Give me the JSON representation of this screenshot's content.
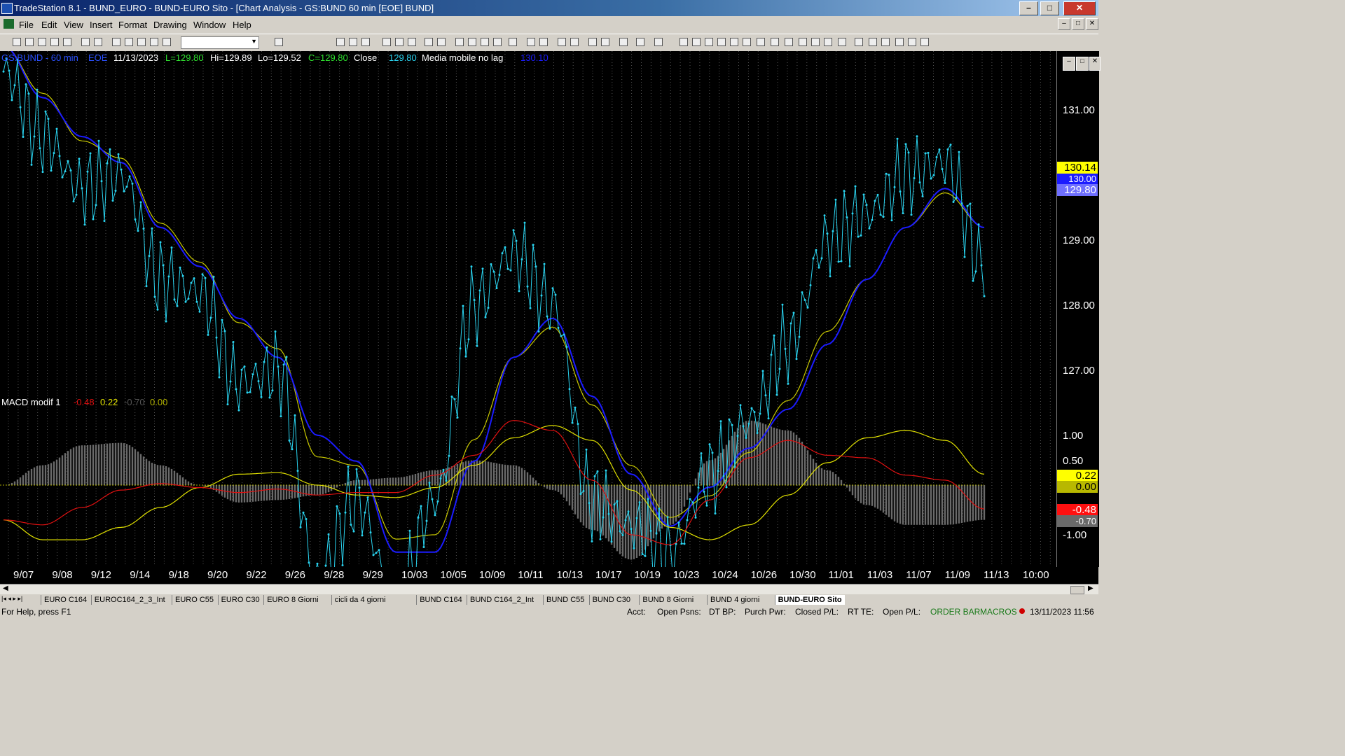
{
  "window": {
    "title": "TradeStation 8.1 - BUND_EURO - BUND-EURO Sito - [Chart Analysis - GS:BUND  60 min  [EOE] BUND]"
  },
  "menu": [
    "File",
    "Edit",
    "View",
    "Insert",
    "Format",
    "Drawing",
    "Window",
    "Help"
  ],
  "header": {
    "symbol": "GS:BUND - 60 min",
    "exchange": "EOE",
    "date": "11/13/2023",
    "last": "L=129.80",
    "hi": "Hi=129.89",
    "lo": "Lo=129.52",
    "close": "C=129.80",
    "close_label": "Close",
    "close_value": "129.80",
    "ma_label": "Media mobile no lag",
    "ma_value": "130.10"
  },
  "macd_header": {
    "label": "MACD modif 1",
    "v1": "-0.48",
    "v2": "0.22",
    "v3": "-0.70",
    "v4": "0.00"
  },
  "colors": {
    "price": "#2ad4f0",
    "ma_blue": "#1b1bff",
    "ma_yellow": "#c8c800",
    "macd_red": "#e01010",
    "macd_yellow": "#e0e000",
    "hist": "#6a6a6a"
  },
  "price_axis": [
    "131.00",
    "129.00",
    "128.00",
    "127.00"
  ],
  "price_labels": {
    "ma": "130.14",
    "hidden": "130.00",
    "close": "129.80"
  },
  "macd_axis": [
    "1.00",
    "0.50",
    "-1.00"
  ],
  "macd_labels": {
    "v2": "0.22",
    "zero": "0.00",
    "v1": "-0.48",
    "v3": "-0.70"
  },
  "chart_data": [
    {
      "type": "line",
      "title": "GS:BUND - 60 min",
      "x": [
        "9/07",
        "9/08",
        "9/12",
        "9/14",
        "9/18",
        "9/20",
        "9/22",
        "9/26",
        "9/28",
        "9/29",
        "10/03",
        "10/05",
        "10/09",
        "10/11",
        "10/13",
        "10/17",
        "10/19",
        "10/23",
        "10/24",
        "10/26",
        "10/30",
        "11/01",
        "11/03",
        "11/07",
        "11/09",
        "11/13"
      ],
      "series": [
        {
          "name": "Close",
          "values": [
            131.3,
            130.8,
            130.4,
            130.5,
            129.7,
            129.6,
            128.9,
            129.0,
            127.4,
            128.0,
            127.2,
            128.0,
            129.5,
            129.9,
            129.5,
            128.0,
            127.8,
            127.6,
            128.2,
            128.6,
            129.2,
            130.0,
            130.2,
            130.5,
            130.6,
            129.8
          ]
        },
        {
          "name": "Media mobile no lag",
          "values": [
            131.5,
            131.1,
            130.8,
            130.6,
            130.1,
            129.8,
            129.4,
            129.1,
            128.5,
            128.3,
            127.6,
            127.6,
            128.3,
            129.1,
            129.4,
            128.8,
            128.2,
            127.8,
            128.1,
            128.4,
            128.7,
            129.2,
            129.7,
            130.1,
            130.4,
            130.1
          ]
        }
      ],
      "ylim": [
        126.6,
        131.5
      ]
    },
    {
      "type": "line",
      "title": "MACD modif 1",
      "x": [
        "9/07",
        "9/08",
        "9/12",
        "9/14",
        "9/18",
        "9/20",
        "9/22",
        "9/26",
        "9/28",
        "9/29",
        "10/03",
        "10/05",
        "10/09",
        "10/11",
        "10/13",
        "10/17",
        "10/19",
        "10/23",
        "10/24",
        "10/26",
        "10/30",
        "11/01",
        "11/03",
        "11/07",
        "11/09",
        "11/13"
      ],
      "series": [
        {
          "values": [
            -0.7,
            -0.8,
            -0.45,
            -0.1,
            0.03,
            -0.05,
            -0.15,
            -0.08,
            -0.2,
            -0.15,
            -0.15,
            0.2,
            0.6,
            1.3,
            1.1,
            0.1,
            -1.0,
            -1.2,
            -0.3,
            0.55,
            0.9,
            0.6,
            0.55,
            0.2,
            0.1,
            -0.48
          ]
        },
        {
          "values": [
            -0.7,
            -1.1,
            -1.1,
            -0.85,
            -0.45,
            -0.05,
            0.22,
            0.25,
            0.0,
            -0.2,
            -0.25,
            -0.05,
            0.4,
            0.95,
            1.2,
            0.9,
            -0.1,
            -0.85,
            -1.1,
            -0.8,
            -0.2,
            0.45,
            0.95,
            1.1,
            0.9,
            0.22
          ]
        },
        {
          "values": [
            0.0,
            0.4,
            0.8,
            0.85,
            0.4,
            0.0,
            -0.35,
            -0.3,
            -0.2,
            0.1,
            0.15,
            0.3,
            0.5,
            0.4,
            -0.1,
            -0.9,
            -1.5,
            -0.8,
            0.5,
            1.3,
            1.1,
            0.3,
            -0.4,
            -0.8,
            -0.8,
            -0.7
          ]
        }
      ],
      "ylim": [
        -1.55,
        1.55
      ]
    }
  ],
  "tabs": [
    "EURO C164",
    "EUROC164_2_3_Int",
    "EURO C55",
    "EURO C30",
    "EURO 8 Giorni",
    "cicli da 4 giorni",
    "BUND C164",
    "BUND C164_2_Int",
    "BUND C55",
    "BUND  C30",
    "BUND 8 Giorni",
    "BUND 4 giorni",
    "BUND-EURO Sito"
  ],
  "status": {
    "help": "For Help, press F1",
    "acct": "Acct:",
    "open_psns": "Open Psns:",
    "dt_bp": "DT BP:",
    "purch_pwr": "Purch Pwr:",
    "closed_pl": "Closed P/L:",
    "rt_te": "RT TE:",
    "open_pl": "Open P/L:",
    "order_bar": "ORDER BAR",
    "macros": "MACROS",
    "datetime": "13/11/2023 11:56"
  },
  "date_axis": [
    "9/07",
    "9/08",
    "9/12",
    "9/14",
    "9/18",
    "9/20",
    "9/22",
    "9/26",
    "9/28",
    "9/29",
    "10/03",
    "10/05",
    "10/09",
    "10/11",
    "10/13",
    "10/17",
    "10/19",
    "10/23",
    "10/24",
    "10/26",
    "10/30",
    "11/01",
    "11/03",
    "11/07",
    "11/09",
    "11/13",
    "10:00"
  ]
}
